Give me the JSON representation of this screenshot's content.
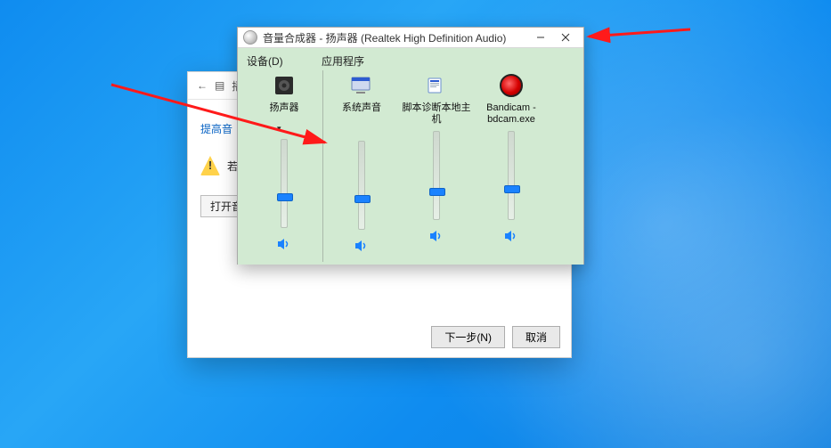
{
  "settings": {
    "back_icon": "←",
    "doc_icon": "▤",
    "title_fragment": "播放设",
    "heading_fragment": "提高音",
    "warn_fragment": "若",
    "open_btn_fragment": "打开音",
    "next_label": "下一步(N)",
    "cancel_label": "取消"
  },
  "mixer": {
    "title": "音量合成器 - 扬声器 (Realtek High Definition Audio)",
    "header_device": "设备(D)",
    "header_apps": "应用程序",
    "columns": [
      {
        "label": "扬声器",
        "icon": "speaker-device",
        "level": 35,
        "is_device": true
      },
      {
        "label": "系统声音",
        "icon": "system-sound",
        "level": 35,
        "is_device": false
      },
      {
        "label": "脚本诊断本地主机",
        "icon": "script-host",
        "level": 32,
        "is_device": false
      },
      {
        "label": "Bandicam - bdcam.exe",
        "icon": "bandicam",
        "level": 35,
        "is_device": false
      }
    ]
  }
}
